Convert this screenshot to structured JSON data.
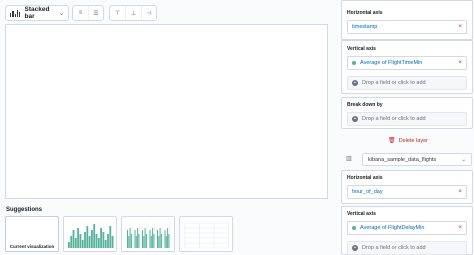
{
  "toolbar": {
    "chart_type_label": "Stacked bar",
    "buttons": [
      "list-icon",
      "list-detail-icon",
      "axis-settings-icon",
      "axis-bottom-icon",
      "axis-right-icon"
    ]
  },
  "suggestions": {
    "title": "Suggestions",
    "items": [
      {
        "label": "Current visualization"
      },
      {
        "label": ""
      },
      {
        "label": ""
      },
      {
        "label": ""
      }
    ]
  },
  "layer1": {
    "horizontal_axis_title": "Horizontal axis",
    "horizontal_axis_value": "timestamp",
    "vertical_axis_title": "Vertical axis",
    "vertical_axis_value": "Average of FlightTimeMin",
    "drop_field": "Drop a field or click to add",
    "breakdown_title": "Break down by",
    "breakdown_drop": "Drop a field or click to add",
    "delete_label": "Delete layer"
  },
  "layer2": {
    "index_pattern": "kibana_sample_data_flights",
    "horizontal_axis_title": "Horizontal axis",
    "horizontal_axis_value": "hour_of_day",
    "vertical_axis_title": "Vertical axis",
    "vertical_axis_value": "Average of FlightDelayMin",
    "drop_field": "Drop a field or click to add"
  },
  "colors": {
    "series": "#54b399",
    "remove": "#bd271e",
    "link": "#006bb4"
  }
}
